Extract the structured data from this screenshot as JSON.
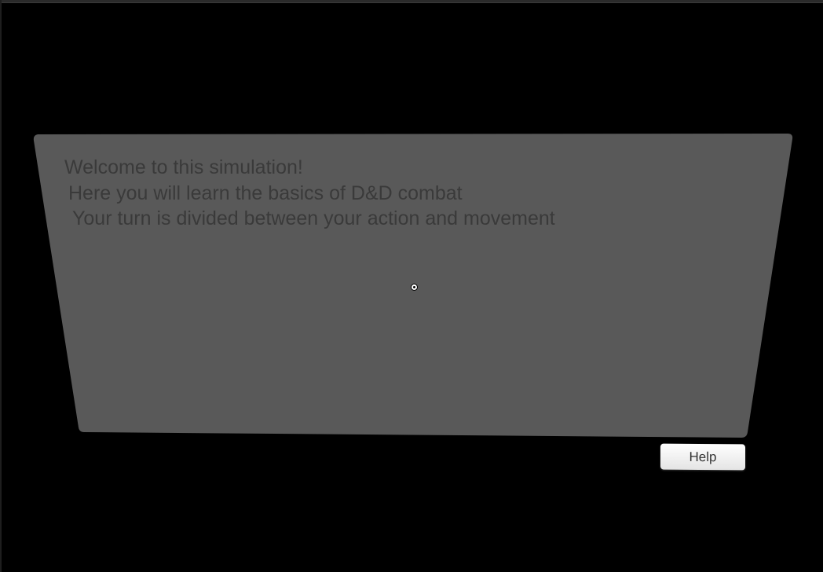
{
  "panel": {
    "lines": [
      "Welcome to this simulation!",
      " Here you will learn the basics of D&D combat",
      "  Your turn is divided between your action and movement"
    ]
  },
  "help_button": {
    "label": "Help"
  },
  "colors": {
    "background": "#000000",
    "panel": "#595959",
    "panel_text": "#3a3a3a",
    "button": "#f4f4f4"
  }
}
